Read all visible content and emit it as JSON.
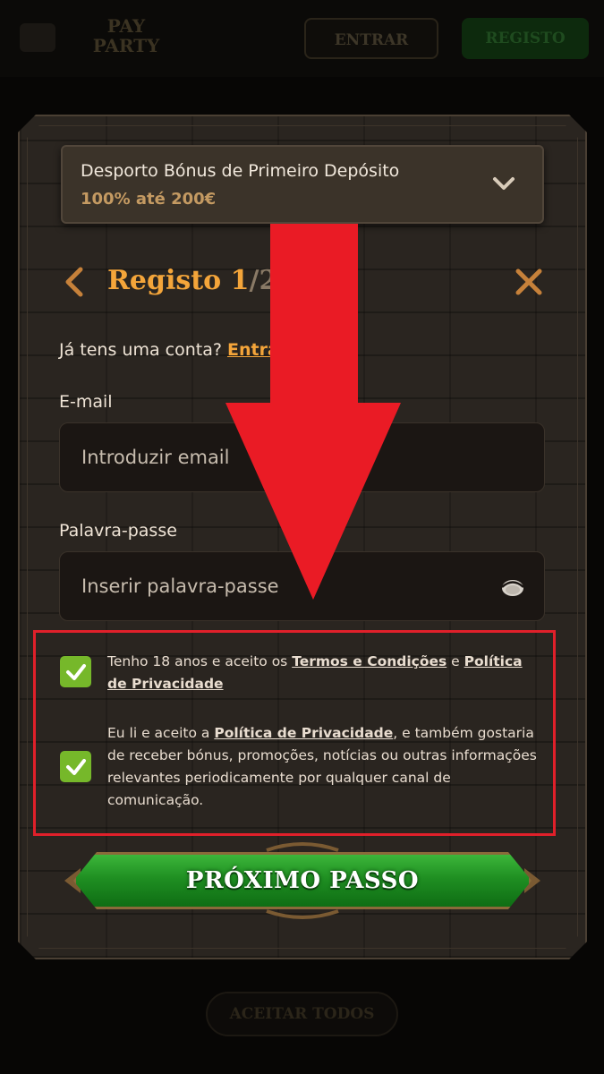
{
  "background": {
    "logo_text": "PAY\nPARTY",
    "login_label": "ENTRAR",
    "register_label": "REGISTO",
    "accept_all_label": "ACEITAR TODOS"
  },
  "bonus": {
    "title": "Desporto Bónus de Primeiro Depósito",
    "subtitle": "100% até 200€"
  },
  "header": {
    "title": "Registo",
    "step_current": "1",
    "step_total": "/2"
  },
  "account_prompt": {
    "text": "Já tens uma conta?",
    "link": "Entrar"
  },
  "email": {
    "label": "E-mail",
    "placeholder": "Introduzir email"
  },
  "password": {
    "label": "Palavra-passe",
    "placeholder": "Inserir palavra-passe"
  },
  "consent": {
    "age": {
      "text_before": "Tenho 18 anos e aceito os ",
      "terms_link": "Termos e Condições",
      "text_mid": " e ",
      "privacy_link": "Política de Privacidade",
      "checked": true
    },
    "marketing": {
      "text_before": "Eu li e aceito a ",
      "privacy_link": "Política de Privacidade",
      "text_after": ", e também gostaria de receber bónus, promoções, notícias ou outras informações relevantes periodicamente por qualquer canal de comunicação.",
      "checked": true
    }
  },
  "next_button": {
    "label": "PRÓXIMO PASSO"
  },
  "colors": {
    "accent": "#f4a53a",
    "checkbox": "#76b82a",
    "highlight": "#e0202a",
    "button_green": "#1f8f22"
  }
}
